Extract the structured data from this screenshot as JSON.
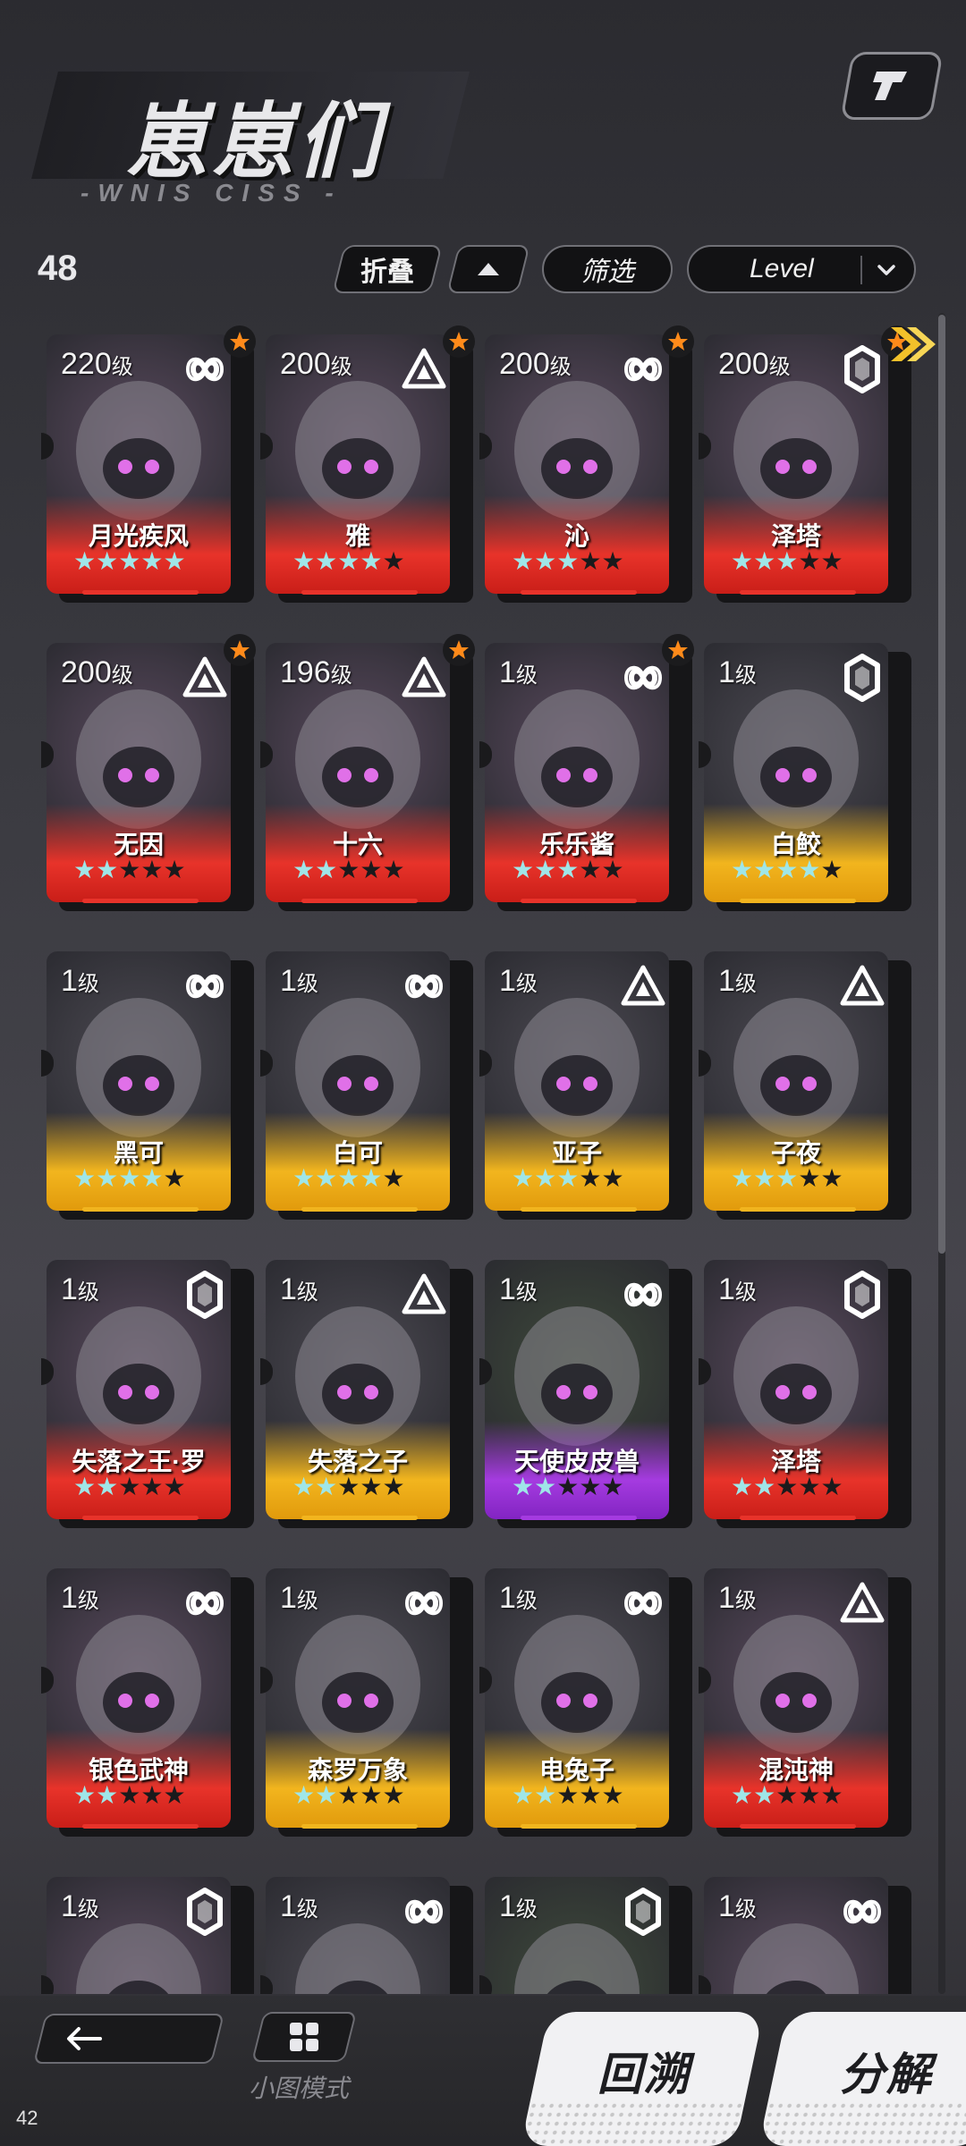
{
  "header": {
    "title": "崽崽们",
    "subtitle": "-WNIS CISS -",
    "count": "48"
  },
  "toolbar": {
    "fold_label": "折叠",
    "filter_label": "筛选",
    "sort_label": "Level"
  },
  "colors": {
    "red": "#e8332a",
    "gold": "#f2b51e",
    "purple": "#a53be0",
    "star_on": "#9fe6e8",
    "badge_star": "#ff8a1a"
  },
  "cards": [
    {
      "level": "220",
      "unit": "级",
      "type": "infinity-icon",
      "name": "月光疾风",
      "rarity": "red",
      "stars": 5,
      "starred": true
    },
    {
      "level": "200",
      "unit": "级",
      "type": "triangle-icon",
      "name": "雅",
      "rarity": "red",
      "stars": 4,
      "starred": true
    },
    {
      "level": "200",
      "unit": "级",
      "type": "infinity-icon",
      "name": "沁",
      "rarity": "red",
      "stars": 3,
      "starred": true
    },
    {
      "level": "200",
      "unit": "级",
      "type": "hexagon-icon",
      "name": "泽塔",
      "rarity": "red",
      "stars": 3,
      "starred": true
    },
    {
      "level": "200",
      "unit": "级",
      "type": "triangle-icon",
      "name": "无因",
      "rarity": "red",
      "stars": 2,
      "starred": true
    },
    {
      "level": "196",
      "unit": "级",
      "type": "triangle-icon",
      "name": "十六",
      "rarity": "red",
      "stars": 2,
      "starred": true
    },
    {
      "level": "1",
      "unit": "级",
      "type": "infinity-icon",
      "name": "乐乐酱",
      "rarity": "red",
      "stars": 3,
      "starred": true
    },
    {
      "level": "1",
      "unit": "级",
      "type": "hexagon-icon",
      "name": "白鲛",
      "rarity": "gold",
      "stars": 4,
      "starred": false
    },
    {
      "level": "1",
      "unit": "级",
      "type": "infinity-icon",
      "name": "黑可",
      "rarity": "gold",
      "stars": 4,
      "starred": false
    },
    {
      "level": "1",
      "unit": "级",
      "type": "infinity-icon",
      "name": "白可",
      "rarity": "gold",
      "stars": 4,
      "starred": false
    },
    {
      "level": "1",
      "unit": "级",
      "type": "triangle-icon",
      "name": "亚子",
      "rarity": "gold",
      "stars": 3,
      "starred": false
    },
    {
      "level": "1",
      "unit": "级",
      "type": "triangle-icon",
      "name": "子夜",
      "rarity": "gold",
      "stars": 3,
      "starred": false
    },
    {
      "level": "1",
      "unit": "级",
      "type": "hexagon-icon",
      "name": "失落之王·罗",
      "rarity": "red",
      "stars": 2,
      "starred": false
    },
    {
      "level": "1",
      "unit": "级",
      "type": "triangle-icon",
      "name": "失落之子",
      "rarity": "gold",
      "stars": 2,
      "starred": false
    },
    {
      "level": "1",
      "unit": "级",
      "type": "infinity-icon",
      "name": "天使皮皮兽",
      "rarity": "purple",
      "stars": 2,
      "starred": false
    },
    {
      "level": "1",
      "unit": "级",
      "type": "hexagon-icon",
      "name": "泽塔",
      "rarity": "red",
      "stars": 2,
      "starred": false
    },
    {
      "level": "1",
      "unit": "级",
      "type": "infinity-icon",
      "name": "银色武神",
      "rarity": "red",
      "stars": 2,
      "starred": false
    },
    {
      "level": "1",
      "unit": "级",
      "type": "infinity-icon",
      "name": "森罗万象",
      "rarity": "gold",
      "stars": 2,
      "starred": false
    },
    {
      "level": "1",
      "unit": "级",
      "type": "infinity-icon",
      "name": "电兔子",
      "rarity": "gold",
      "stars": 2,
      "starred": false
    },
    {
      "level": "1",
      "unit": "级",
      "type": "triangle-icon",
      "name": "混沌神",
      "rarity": "red",
      "stars": 2,
      "starred": false
    },
    {
      "level": "1",
      "unit": "级",
      "type": "hexagon-icon",
      "name": "",
      "rarity": "red",
      "stars": 0,
      "starred": false
    },
    {
      "level": "1",
      "unit": "级",
      "type": "infinity-icon",
      "name": "",
      "rarity": "gold",
      "stars": 0,
      "starred": false
    },
    {
      "level": "1",
      "unit": "级",
      "type": "hexagon-icon",
      "name": "",
      "rarity": "purple",
      "stars": 0,
      "starred": false
    },
    {
      "level": "1",
      "unit": "级",
      "type": "infinity-icon",
      "name": "",
      "rarity": "red",
      "stars": 0,
      "starred": false
    }
  ],
  "footer": {
    "mini_mode_label": "小图模式",
    "rewind_label": "回溯",
    "decompose_label": "分解",
    "fps": "42"
  }
}
